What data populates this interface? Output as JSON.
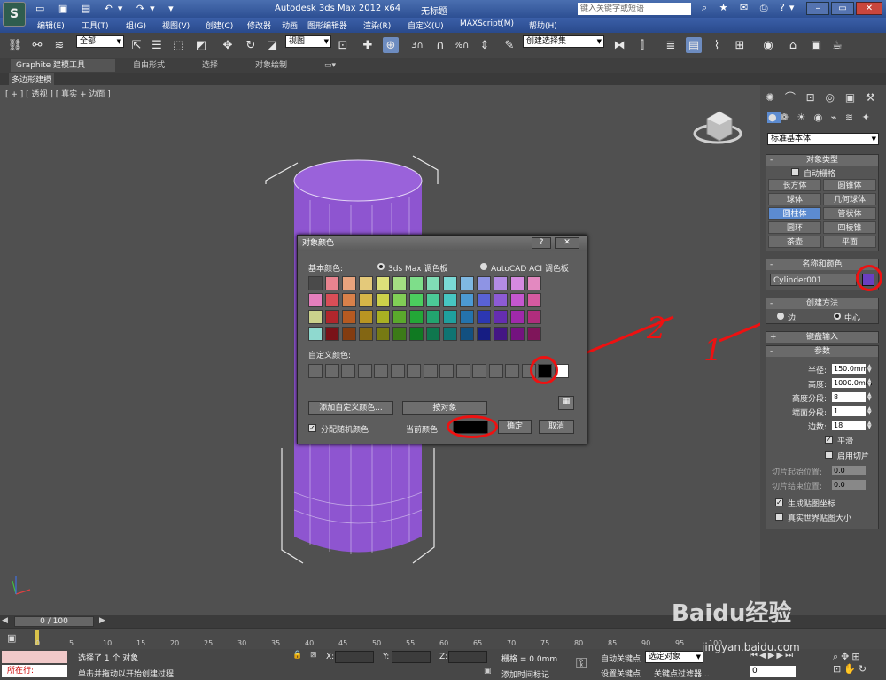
{
  "app": {
    "title": "Autodesk 3ds Max  2012 x64",
    "doc_title": "无标题",
    "search_placeholder": "键入关键字或短语"
  },
  "menu": [
    "编辑(E)",
    "工具(T)",
    "组(G)",
    "视图(V)",
    "创建(C)",
    "修改器",
    "动画",
    "图形编辑器",
    "渲染(R)",
    "自定义(U)",
    "MAXScript(M)",
    "帮助(H)"
  ],
  "toolbar": {
    "selection_filter": "全部",
    "ref_coord": "视图",
    "named_selection": "创建选择集"
  },
  "ribbon": {
    "tabs": [
      "Graphite 建模工具",
      "自由形式",
      "选择",
      "对象绘制"
    ],
    "subtab": "多边形建模"
  },
  "viewport": {
    "label": "[ + ] [ 透视 ] [ 真实 + 边面 ]",
    "object_color": "#8e55d0"
  },
  "command_panel": {
    "category": "标准基本体",
    "object_type_title": "对象类型",
    "autogrid_label": "自动栅格",
    "buttons": [
      "长方体",
      "圆锥体",
      "球体",
      "几何球体",
      "圆柱体",
      "管状体",
      "圆环",
      "四棱锥",
      "茶壶",
      "平面"
    ],
    "active_button": "圆柱体",
    "name_color_title": "名称和颜色",
    "object_name": "Cylinder001",
    "object_color": "#6a3fc0",
    "creation_method_title": "创建方法",
    "creation_methods": [
      "边",
      "中心"
    ],
    "creation_method_selected": "中心",
    "keyboard_entry_title": "键盘输入",
    "params_title": "参数",
    "params": [
      {
        "label": "半径:",
        "value": "150.0mm"
      },
      {
        "label": "高度:",
        "value": "1000.0mm"
      },
      {
        "label": "高度分段:",
        "value": "8"
      },
      {
        "label": "端面分段:",
        "value": "1"
      },
      {
        "label": "边数:",
        "value": "18"
      }
    ],
    "smooth_label": "平滑",
    "slice_on_label": "启用切片",
    "slice_from_label": "切片起始位置:",
    "slice_from_value": "0.0",
    "slice_to_label": "切片结束位置:",
    "slice_to_value": "0.0",
    "gen_mapping_label": "生成贴图坐标",
    "real_world_label": "真实世界贴图大小"
  },
  "dialog": {
    "title": "对象颜色",
    "help_btn": "?",
    "close_btn": "✕",
    "basic_colors_label": "基本颜色:",
    "palette_max": "3ds Max 调色板",
    "palette_acad": "AutoCAD ACI 调色板",
    "custom_colors_label": "自定义颜色:",
    "add_custom_btn": "添加自定义颜色...",
    "by_object_btn": "按对象",
    "assign_random_label": "分配随机颜色",
    "current_color_label": "当前颜色:",
    "current_color": "#000000",
    "ok_btn": "确定",
    "cancel_btn": "取消",
    "swatches": [
      [
        "#4a4a4a",
        "#e8838f",
        "#e8a37d",
        "#e4c97a",
        "#dde07a",
        "#a4de82",
        "#7ede8a",
        "#80ddb6",
        "#7ad9d6",
        "#7fb8e2",
        "#8e94e4",
        "#b38be4",
        "#d58ae0",
        "#e389c0"
      ],
      [
        "#e57fbd",
        "#d94e57",
        "#d9814a",
        "#d6b548",
        "#cdd24a",
        "#81cf56",
        "#4bcd5e",
        "#4bca97",
        "#47c6c2",
        "#4c9ad3",
        "#5962d6",
        "#8d5bd5",
        "#c457d0",
        "#d65aa1"
      ],
      [
        "#cbd28c",
        "#b1262c",
        "#b65a21",
        "#b99522",
        "#a9b022",
        "#5aa92c",
        "#23a737",
        "#22a46f",
        "#1ea09e",
        "#2473ad",
        "#2c37b2",
        "#652db0",
        "#a029ab",
        "#b02d7d"
      ],
      [
        "#8fd9cf",
        "#7a1318",
        "#833c10",
        "#836613",
        "#777a13",
        "#3c7a18",
        "#107a22",
        "#0f774e",
        "#0e7472",
        "#125080",
        "#161d83",
        "#441684",
        "#74137f",
        "#7f155a"
      ]
    ],
    "custom_swatches": [
      "#6a6a6a",
      "#6a6a6a",
      "#6a6a6a",
      "#6a6a6a",
      "#6a6a6a",
      "#6a6a6a",
      "#6a6a6a",
      "#6a6a6a",
      "#6a6a6a",
      "#6a6a6a",
      "#6a6a6a",
      "#6a6a6a",
      "#6a6a6a",
      "#6a6a6a",
      "#000000",
      "#ffffff"
    ]
  },
  "annotations": {
    "n1": "1",
    "n2": "2"
  },
  "timeline": {
    "frame": "0 / 100",
    "ticks": [
      "0",
      "5",
      "10",
      "15",
      "20",
      "25",
      "30",
      "35",
      "40",
      "45",
      "50",
      "55",
      "60",
      "65",
      "70",
      "75",
      "80",
      "85",
      "90",
      "95",
      "100"
    ]
  },
  "status": {
    "script_label": "所在行:",
    "selected_text": "选择了 1 个 对象",
    "prompt_text": "单击并拖动以开始创建过程",
    "x_label": "X:",
    "y_label": "Y:",
    "z_label": "Z:",
    "grid_text": "栅格 = 0.0mm",
    "add_time_tag": "添加时间标记",
    "auto_key": "自动关键点",
    "set_key": "设置关键点",
    "selected_dd": "选定对象",
    "key_filters": "关键点过滤器...",
    "frame_value": "0"
  },
  "watermark": {
    "brand": "Baidu经验",
    "url": "jingyan.baidu.com"
  }
}
